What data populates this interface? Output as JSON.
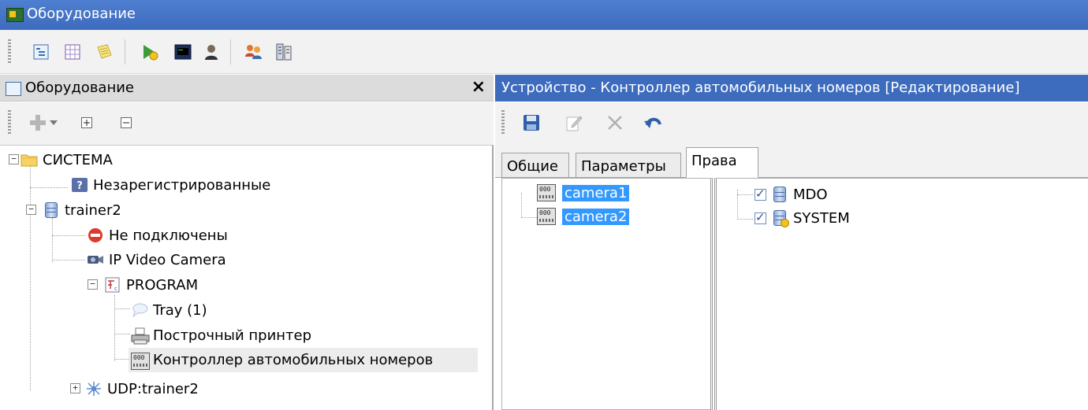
{
  "window": {
    "title": "Оборудование"
  },
  "main_toolbar": {
    "icons": [
      "tree-view-icon",
      "grid-view-icon",
      "notes-icon",
      "run-icon",
      "terminal-icon",
      "user-icon",
      "users-icon",
      "hardware-icon"
    ]
  },
  "left_panel": {
    "title": "Оборудование",
    "close_label": "×",
    "toolbar_icons": [
      "add-icon",
      "dropdown-arrow-icon",
      "expand-all-icon",
      "collapse-all-icon"
    ],
    "tree": [
      {
        "label": "СИСТЕМА",
        "icon": "folder-icon"
      },
      {
        "label": "Незарегистрированные",
        "icon": "question-icon"
      },
      {
        "label": "trainer2",
        "icon": "server-icon"
      },
      {
        "label": "Не подключены",
        "icon": "stop-icon"
      },
      {
        "label": "IP Video Camera",
        "icon": "camera-icon"
      },
      {
        "label": "PROGRAM",
        "icon": "program-icon"
      },
      {
        "label": "Tray (1)",
        "icon": "tray-icon"
      },
      {
        "label": "Построчный принтер",
        "icon": "printer-icon"
      },
      {
        "label": "Контроллер автомобильных номеров",
        "icon": "plate-controller-icon"
      },
      {
        "label": "UDP:trainer2",
        "icon": "network-icon"
      }
    ]
  },
  "right_panel": {
    "title": "Устройство - Контроллер автомобильных номеров [Редактирование]",
    "toolbar_icons": [
      "save-icon",
      "edit-icon",
      "delete-icon",
      "undo-icon"
    ],
    "tabs": [
      "Общие",
      "Параметры",
      "Права"
    ],
    "active_tab": "Права",
    "devices": [
      "camera1",
      "camera2"
    ],
    "rights": [
      {
        "label": "MDO",
        "checked": true
      },
      {
        "label": "SYSTEM",
        "checked": true
      }
    ]
  },
  "colors": {
    "title_bar": "#3d6bbd",
    "selection": "#3399ff",
    "hover_row": "#ececec"
  }
}
